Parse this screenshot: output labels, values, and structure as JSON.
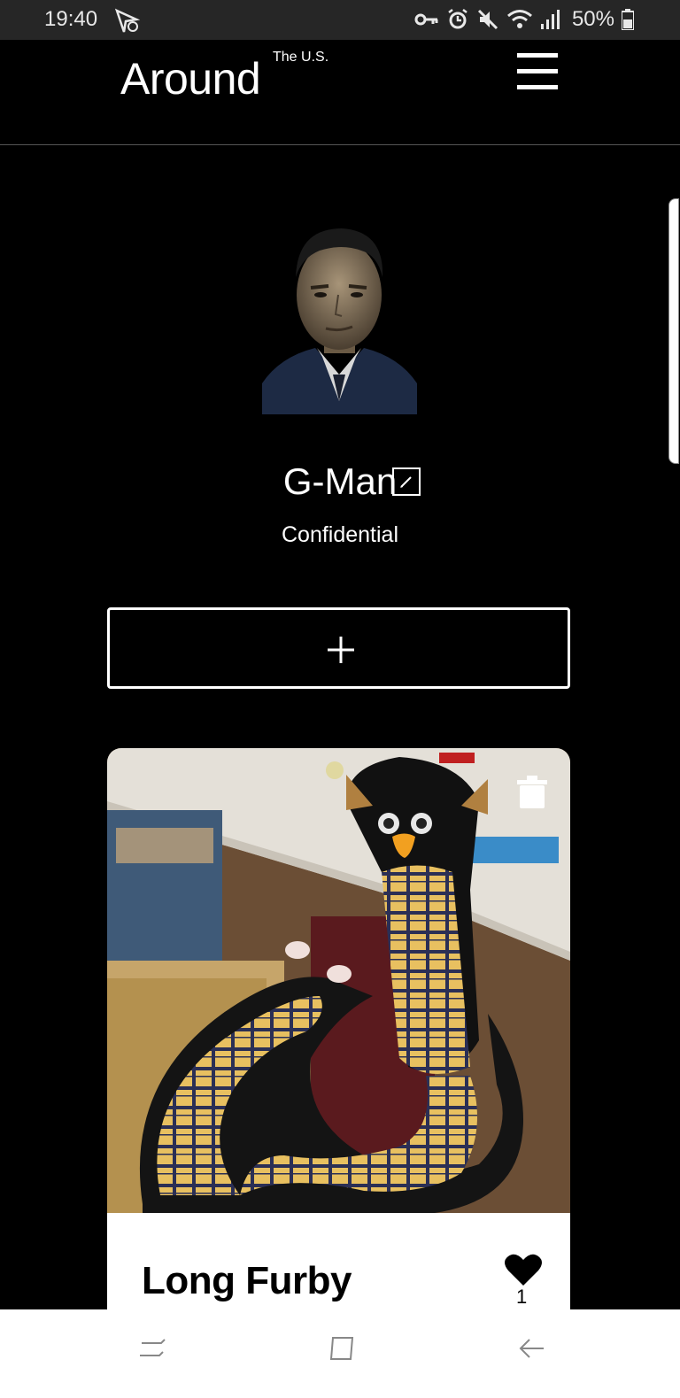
{
  "status_bar": {
    "time": "19:40",
    "battery": "50%",
    "icons": [
      "navigation-icon",
      "vpn-key-icon",
      "alarm-icon",
      "mute-icon",
      "wifi-icon",
      "signal-icon",
      "battery-icon"
    ]
  },
  "header": {
    "brand": "Around",
    "brand_sup": "The U.S.",
    "menu_icon": "hamburger-menu-icon"
  },
  "profile": {
    "name": "G-Man",
    "bio": "Confidential",
    "edit_icon": "edit-icon",
    "avatar": "avatar"
  },
  "add_button": {
    "icon": "plus-icon"
  },
  "cards": [
    {
      "title": "Long Furby",
      "likes": "1",
      "image": "card-image"
    }
  ],
  "colors": {
    "background": "#000000",
    "foreground": "#ffffff",
    "card_footer": "#ffffff",
    "status_bar": "#262626"
  },
  "nav_bar": {
    "icons": [
      "recents-icon",
      "home-icon",
      "back-icon"
    ]
  }
}
